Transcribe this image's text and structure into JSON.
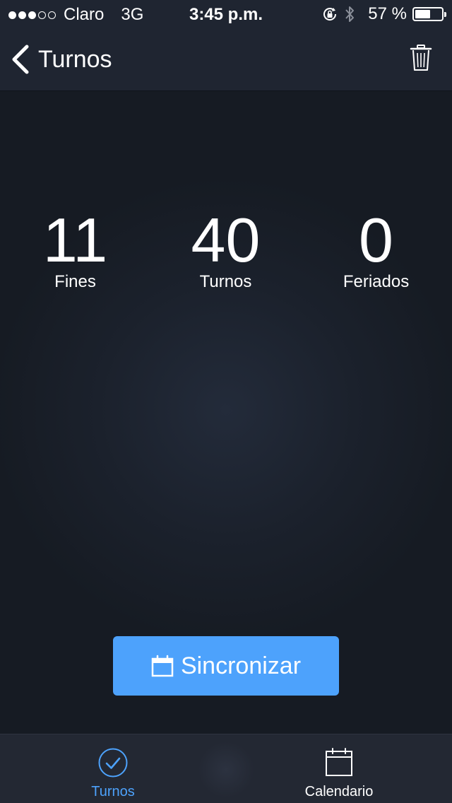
{
  "status_bar": {
    "signal": {
      "filled": 3,
      "empty": 2
    },
    "carrier": "Claro",
    "network": "3G",
    "time": "3:45 p.m.",
    "battery_percent_label": "57 %",
    "battery_level": 0.57,
    "icons": [
      "rotation-lock-icon",
      "bluetooth-icon",
      "battery-icon"
    ]
  },
  "nav": {
    "back_label": "Turnos",
    "icons": [
      "chevron-left-icon",
      "trash-icon"
    ]
  },
  "stats": [
    {
      "value": "11",
      "label": "Fines"
    },
    {
      "value": "40",
      "label": "Turnos"
    },
    {
      "value": "0",
      "label": "Feriados"
    }
  ],
  "sync_button": {
    "label": "Sincronizar",
    "icon": "calendar-icon"
  },
  "tab_bar": {
    "tabs": [
      {
        "label": "Turnos",
        "icon": "checkmark-circle-icon",
        "active": true
      },
      {
        "label": "Calendario",
        "icon": "calendar-icon",
        "active": false
      }
    ]
  },
  "colors": {
    "accent": "#4da2fc",
    "background": "#161b23",
    "bar": "#1f2531",
    "tab_bar": "#232833",
    "text": "#ffffff"
  }
}
